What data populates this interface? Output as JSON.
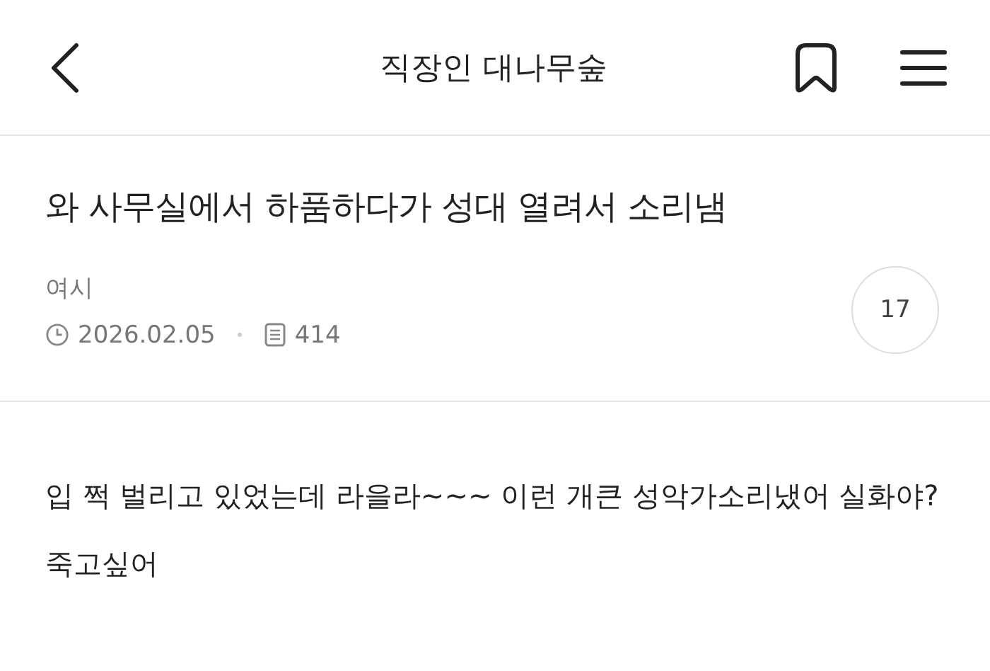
{
  "header": {
    "title": "직장인 대나무숲"
  },
  "post": {
    "title": "와 사무실에서 하품하다가 성대 열려서 소리냄",
    "author": "여시",
    "date": "2026.02.05",
    "views": "414",
    "comment_count": "17"
  },
  "body": {
    "text": "입 쩍 벌리고 있었는데 라을라~~~ 이런 개큰 성악가소리냈어 실화야? 죽고싶어"
  }
}
